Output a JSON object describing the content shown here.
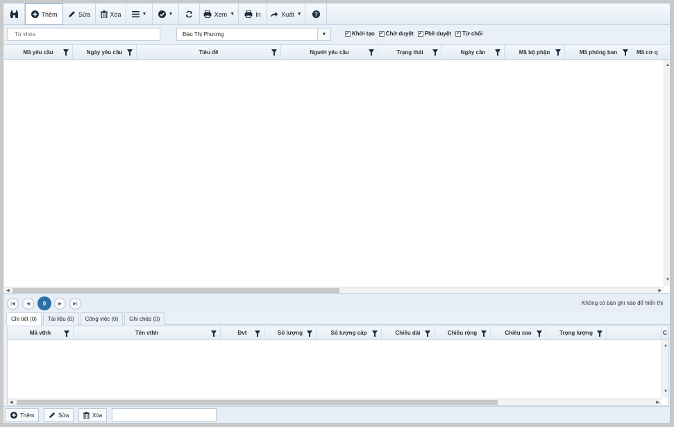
{
  "toolbar": {
    "add": "Thêm",
    "edit": "Sửa",
    "delete": "Xóa",
    "view": "Xem",
    "print": "In",
    "export": "Xuất"
  },
  "filter": {
    "keyword_placeholder": "Từ khóa",
    "requester_value": "Đào Thị Phương",
    "statuses": [
      "Khởi tạo",
      "Chờ duyệt",
      "Phê duyệt",
      "Từ chối"
    ]
  },
  "top_grid": {
    "columns": [
      "Mã yêu cầu",
      "Ngày yêu cầu",
      "Tiêu đề",
      "Người yêu cầu",
      "Trạng thái",
      "Ngày cần",
      "Mã bộ phận",
      "Mã phòng ban",
      "Mã cơ q"
    ]
  },
  "pager": {
    "current_page": "0",
    "info": "Không có bản ghi nào để hiển thị"
  },
  "tabs": [
    "Chi tiết (0)",
    "Tài liệu (0)",
    "Công việc (0)",
    "Ghi chép (0)"
  ],
  "bottom_grid": {
    "columns": [
      "Mã vthh",
      "Tên vthh",
      "Đvt",
      "Số lượng",
      "Số lượng cấp",
      "Chiều dài",
      "Chiều rộng",
      "Chiều cao",
      "Trọng lượng",
      "",
      "C"
    ]
  },
  "bottom_toolbar": {
    "add": "Thêm",
    "edit": "Sửa",
    "delete": "Xóa",
    "input_value": ""
  }
}
